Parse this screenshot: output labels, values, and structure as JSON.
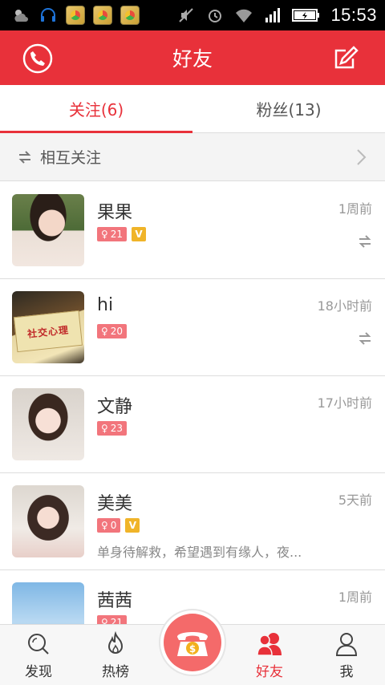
{
  "status_bar": {
    "time": "15:53"
  },
  "header": {
    "title": "好友",
    "left_icon": "phone-icon",
    "right_icon": "edit-icon"
  },
  "tabs": [
    {
      "label": "关注(6)",
      "active": true
    },
    {
      "label": "粉丝(13)",
      "active": false
    }
  ],
  "mutual": {
    "label": "相互关注"
  },
  "friends": [
    {
      "name": "果果",
      "time": "1周前",
      "age": "21",
      "vip": true,
      "signature": "",
      "mutual": true
    },
    {
      "name": "hi",
      "time": "18小时前",
      "age": "20",
      "vip": false,
      "signature": "",
      "mutual": true
    },
    {
      "name": "文静",
      "time": "17小时前",
      "age": "23",
      "vip": false,
      "signature": "",
      "mutual": false
    },
    {
      "name": "美美",
      "time": "5天前",
      "age": "0",
      "vip": true,
      "signature": "单身待解救，希望遇到有缘人，夜...",
      "mutual": false
    },
    {
      "name": "茜茜",
      "time": "1周前",
      "age": "21",
      "vip": false,
      "signature": "",
      "mutual": false
    }
  ],
  "avatar2_text": "社交心理",
  "vip_label": "V",
  "bottom_nav": [
    {
      "label": "发现",
      "icon": "search-icon"
    },
    {
      "label": "热榜",
      "icon": "flame-icon"
    },
    {
      "label": "好友",
      "icon": "friends-icon",
      "active": true
    },
    {
      "label": "我",
      "icon": "person-icon"
    }
  ],
  "colors": {
    "accent": "#e8313a",
    "age_badge": "#f2757c",
    "vip": "#f0b429"
  }
}
